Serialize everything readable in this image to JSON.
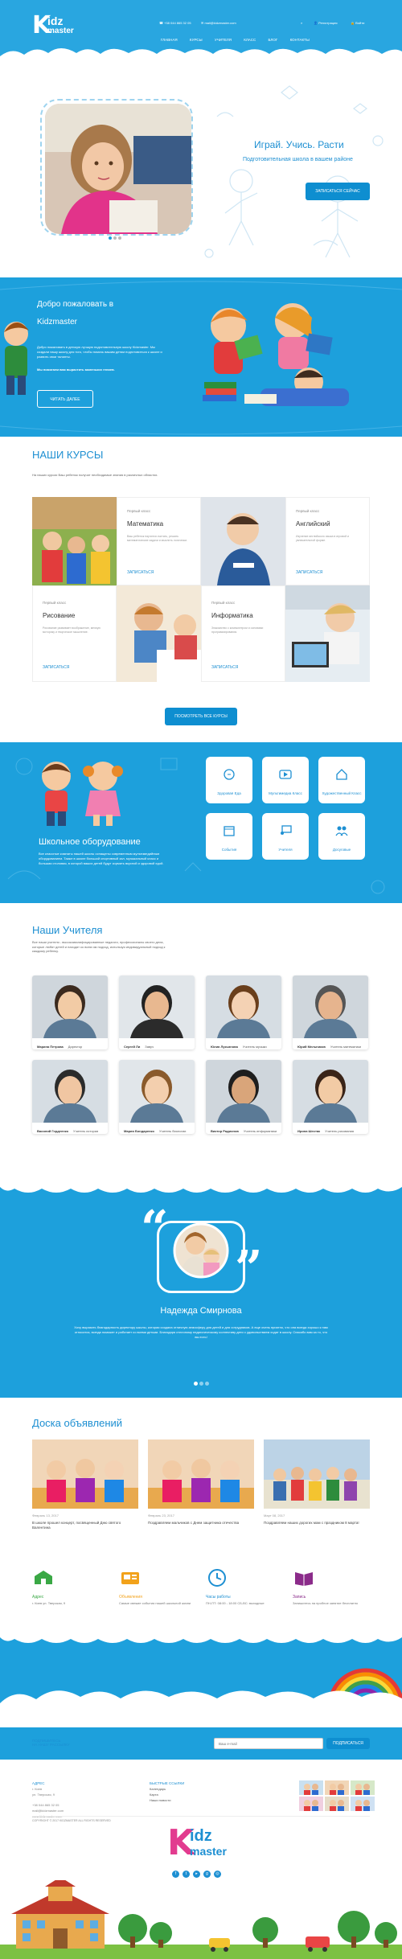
{
  "header": {
    "logo_top": "idz",
    "logo_bottom": "master",
    "logo_k": "K",
    "phone": "+38 044 865 32 05",
    "email": "mail@kidzmaster.com",
    "register": "Регистрация",
    "login": "Войти",
    "nav": [
      "ГЛАВНАЯ",
      "КУРСЫ",
      "УЧИТЕЛЯ",
      "КЛАСС",
      "БЛОГ",
      "КОНТАКТЫ"
    ]
  },
  "hero": {
    "title": "Играй. Учись. Расти",
    "subtitle": "Подготовительная школа в вашем районе",
    "button": "ЗАПИСАТЬСЯ СЕЙЧАС"
  },
  "welcome": {
    "title_line1": "Добро пожаловать в",
    "title_line2": "Kidzmaster",
    "text": "Добро пожаловать в детскую лучшую подготовительную школу Kidzmaster. Мы создали нашу школу для того, чтобы помочь вашим детям подготовиться к школе и развить свои таланты.",
    "text2": "Мы помогаем вам вырастить маленьких гениев.",
    "button": "ЧИТАТЬ ДАЛЕЕ"
  },
  "courses": {
    "title": "НАШИ КУРСЫ",
    "intro": "На наших курсах Ваш ребенок получит необходимые знания в различных областях.",
    "items": [
      {
        "grade": "Первый класс",
        "name": "Математика",
        "text": "Ваш ребенок научится считать, решать математические задачи и мыслить логически.",
        "link": "ЗАПИСАТЬСЯ"
      },
      {
        "grade": "Первый класс",
        "name": "Английский",
        "text": "Изучение английского языка в игровой и увлекательной форме.",
        "link": "ЗАПИСАТЬСЯ"
      },
      {
        "grade": "Первый класс",
        "name": "Рисование",
        "text": "Рисование развивает воображение, мелкую моторику и творческое мышление.",
        "link": "ЗАПИСАТЬСЯ"
      },
      {
        "grade": "Первый класс",
        "name": "Информатика",
        "text": "Знакомство с компьютером и основами программирования.",
        "link": "ЗАПИСАТЬСЯ"
      }
    ],
    "button": "ПОСМОТРЕТЬ ВСЕ КУРСЫ"
  },
  "equipment": {
    "title": "Школьное оборудование",
    "text": "Все классные комнаты нашей школы оснащены современным мультимедийным оборудованием. Также в школе большой спортивный зал, музыкальный класс и большая столовая, в которой ваших детей будут кормить вкусной и здоровой едой.",
    "tiles": [
      "Здоровая Еда",
      "Мультимедиа Класс",
      "Художественный Класс",
      "События",
      "Учителя",
      "Досуговые"
    ]
  },
  "teachers": {
    "title": "Наши Учителя",
    "intro": "Все наши учителя - высококвалифицированные педагоги, профессионалы своего дела, которые любят детей и находят ко всем им подход, используя индивидуальный подход к каждому ребенку.",
    "items": [
      {
        "name": "Марина Петрова",
        "role": "Директор"
      },
      {
        "name": "Сергей Ли",
        "role": "Завуч"
      },
      {
        "name": "Юлия Лукьянова",
        "role": "Учитель музыки"
      },
      {
        "name": "Юрий Мельников",
        "role": "Учитель математики"
      },
      {
        "name": "Василий Гордеенко",
        "role": "Учитель истории"
      },
      {
        "name": "Мария Бондаренко",
        "role": "Учитель биологии"
      },
      {
        "name": "Виктор Радионов",
        "role": "Учитель информатики"
      },
      {
        "name": "Ирина Шестак",
        "role": "Учитель рисования"
      }
    ]
  },
  "testimonial": {
    "name": "Надежда Смирнова",
    "text": "Хочу выразить благодарность директору школы, которая создала отличную атмосферу для детей и для сотрудников. А еще очень приятно, что она всегда хорошо к нам относится, всегда поможет и работает со всеми детьми. Благодаря отличному педагогическому коллективу дети с удовольствием ходят в школу. Спасибо вам за то, что вы есть!"
  },
  "news": {
    "title": "Доска объявлений",
    "items": [
      {
        "date": "Февраль 13, 2017",
        "text": "В школе прошел концерт, посвященный Дню святого Валентина"
      },
      {
        "date": "Февраль 23, 2017",
        "text": "Поздравляем мальчиков с Днем защитника отечества"
      },
      {
        "date": "Март 08, 2017",
        "text": "Поздравляем наших дорогих мам с праздником 8 марта!"
      }
    ]
  },
  "info": [
    {
      "title": "Адрес",
      "text": "г. Киев ул. Тверская, 9"
    },
    {
      "title": "Объявления",
      "text": "Самые свежие события нашей школьной жизни"
    },
    {
      "title": "Часы работы",
      "text": "ПН-ПТ: 08:00 - 18:00  СБ-ВС: выходные"
    },
    {
      "title": "Запись",
      "text": "Запишитесь на пробное занятие бесплатно"
    }
  ],
  "subscribe": {
    "label_line1": "ПОДПИШИТЕСЬ",
    "label_line2": "НА НАШУ РАССЫЛКУ",
    "placeholder": "Ваш e-mail",
    "button": "ПОДПИСАТЬСЯ"
  },
  "footer": {
    "col1_title": "АДРЕС",
    "col1_lines": [
      "г. Киев",
      "ул. Тверская, 9",
      "+38 044 865 32 05",
      "mail@kidzmaster.com",
      "www.kidzmaster.com"
    ],
    "col2_title": "БЫСТРЫЕ ССЫЛКИ",
    "col2_links": [
      "Календарь",
      "Карта",
      "Наши новости"
    ],
    "copyright": "COPYRIGHT © 2017 KIDZMASTER ALL RIGHTS RESERVED"
  },
  "colors": {
    "primary": "#1da0dc",
    "accent": "#0e8ed0",
    "address_icon": "#3aa845",
    "news_icon": "#f2a21b",
    "hours_icon": "#1d8fd2",
    "enroll_icon": "#8b2b8a"
  }
}
